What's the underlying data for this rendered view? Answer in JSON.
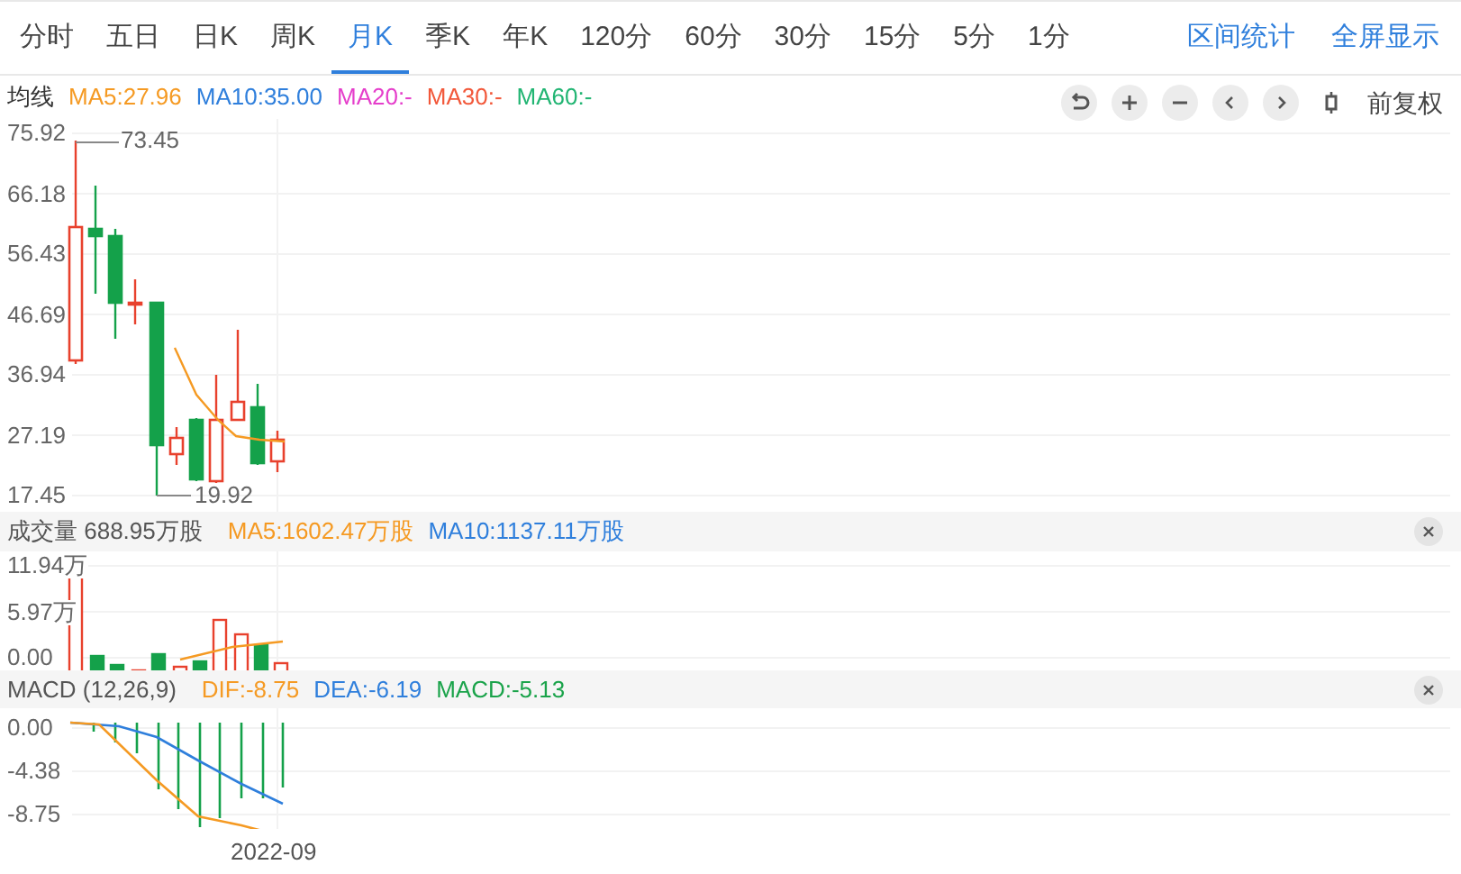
{
  "period_tabs": [
    {
      "label": "分时",
      "selected": false
    },
    {
      "label": "五日",
      "selected": false
    },
    {
      "label": "日K",
      "selected": false
    },
    {
      "label": "周K",
      "selected": false
    },
    {
      "label": "月K",
      "selected": true
    },
    {
      "label": "季K",
      "selected": false
    },
    {
      "label": "年K",
      "selected": false
    },
    {
      "label": "120分",
      "selected": false
    },
    {
      "label": "60分",
      "selected": false
    },
    {
      "label": "30分",
      "selected": false
    },
    {
      "label": "15分",
      "selected": false
    },
    {
      "label": "5分",
      "selected": false
    },
    {
      "label": "1分",
      "selected": false
    }
  ],
  "tools": [
    "区间统计",
    "全屏显示"
  ],
  "price_panel": {
    "title": "均线",
    "legend": [
      {
        "text": "MA5:27.96",
        "color": "#f59a23"
      },
      {
        "text": "MA10:35.00",
        "color": "#2f7fdc"
      },
      {
        "text": "MA20:-",
        "color": "#e53ecb"
      },
      {
        "text": "MA30:-",
        "color": "#f2583a"
      },
      {
        "text": "MA60:-",
        "color": "#22b573"
      }
    ],
    "toolbar_buttons": [
      {
        "kind": "reset"
      },
      {
        "kind": "zoom-in"
      },
      {
        "kind": "zoom-out"
      },
      {
        "kind": "left"
      },
      {
        "kind": "right"
      },
      {
        "kind": "candle"
      }
    ],
    "adjust": "前复权",
    "y_ticks": [
      "75.92",
      "66.18",
      "56.43",
      "46.69",
      "36.94",
      "27.19",
      "17.45"
    ],
    "high_label": "73.45",
    "low_label": "19.92"
  },
  "volume_panel": {
    "title": "成交量 688.95万股",
    "legend": [
      {
        "text": "MA5:1602.47万股",
        "color": "#f59a23"
      },
      {
        "text": "MA10:1137.11万股",
        "color": "#2f7fdc"
      }
    ],
    "y_ticks": [
      "11.94万",
      "5.97万",
      "0.00"
    ]
  },
  "macd_panel": {
    "title": "MACD (12,26,9)",
    "legend": [
      {
        "text": "DIF:-8.75",
        "color": "#f59a23"
      },
      {
        "text": "DEA:-6.19",
        "color": "#2f7fdc"
      },
      {
        "text": "MACD:-5.13",
        "color": "#1aa34a"
      }
    ],
    "y_ticks": [
      "0.00",
      "-4.38",
      "-8.75"
    ]
  },
  "x_axis_label": "2022-09"
}
